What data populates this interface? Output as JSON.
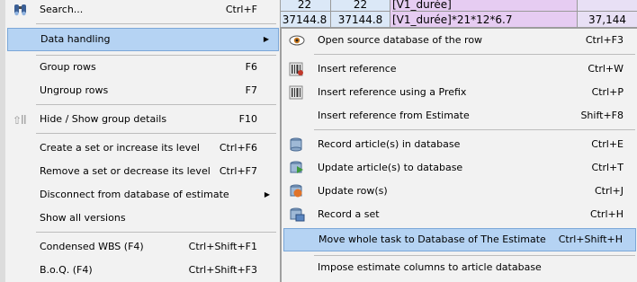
{
  "background": {
    "cells_top": [
      "22",
      "22",
      "[V1_durée]"
    ],
    "cells_bottom": [
      "37144.8",
      "37144.8",
      "[V1_durée]*21*12*6.7",
      "37,144"
    ]
  },
  "main_menu": {
    "items": [
      {
        "label": "Search...",
        "shortcut": "Ctrl+F"
      },
      {
        "label": "Data handling",
        "shortcut": ""
      },
      {
        "label": "Group rows",
        "shortcut": "F6"
      },
      {
        "label": "Ungroup rows",
        "shortcut": "F7"
      },
      {
        "label": "Hide / Show group details",
        "shortcut": "F10"
      },
      {
        "label": "Create a set or increase its level",
        "shortcut": "Ctrl+F6"
      },
      {
        "label": "Remove a set or decrease its level",
        "shortcut": "Ctrl+F7"
      },
      {
        "label": "Disconnect from database of estimate",
        "shortcut": ""
      },
      {
        "label": "Show all versions",
        "shortcut": ""
      },
      {
        "label": "Condensed WBS (F4)",
        "shortcut": "Ctrl+Shift+F1"
      },
      {
        "label": "B.o.Q. (F4)",
        "shortcut": "Ctrl+Shift+F3"
      }
    ]
  },
  "submenu": {
    "items": [
      {
        "label": "Open source database of the row",
        "shortcut": "Ctrl+F3",
        "icon": "eye-icon"
      },
      {
        "label": "Insert reference",
        "shortcut": "Ctrl+W",
        "icon": "barcode-insert-icon"
      },
      {
        "label": "Insert reference using a Prefix",
        "shortcut": "Ctrl+P",
        "icon": "barcode-prefix-icon"
      },
      {
        "label": "Insert reference from Estimate",
        "shortcut": "Shift+F8",
        "icon": ""
      },
      {
        "label": "Record article(s) in database",
        "shortcut": "Ctrl+E",
        "icon": "database-record-icon"
      },
      {
        "label": "Update article(s) to database",
        "shortcut": "Ctrl+T",
        "icon": "database-update-icon"
      },
      {
        "label": "Update row(s)",
        "shortcut": "Ctrl+J",
        "icon": "row-update-icon"
      },
      {
        "label": "Record a set",
        "shortcut": "Ctrl+H",
        "icon": "set-record-icon"
      },
      {
        "label": "Move whole task to Database of The Estimate",
        "shortcut": "Ctrl+Shift+H",
        "icon": ""
      },
      {
        "label": "Impose estimate columns to article database",
        "shortcut": "",
        "icon": ""
      }
    ]
  }
}
